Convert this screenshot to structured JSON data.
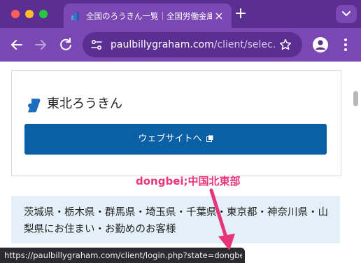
{
  "browser": {
    "tab_title": "全国のろうきん一覧｜全国労働金庫協会",
    "url_host": "paulbillygraham.com",
    "url_path": "/client/selec...",
    "status_url": "https://paulbillygraham.com/client/login.php?state=dongbei",
    "accent_color": "#5b2f91"
  },
  "card": {
    "bank_name": "東北ろうきん",
    "website_button_label": "ウェブサイトへ"
  },
  "prefectures": {
    "text": "茨城県・栃木県・群馬県・埼玉県・千葉県・東京都・神奈川県・山梨県にお住まい・お勤めのお客様"
  },
  "annotation": {
    "text": "dongbei;中国北東部",
    "color": "#e8357a"
  }
}
